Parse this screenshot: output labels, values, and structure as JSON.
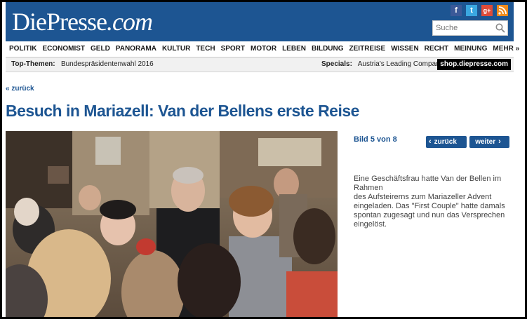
{
  "header": {
    "logo_main": "DiePresse",
    "logo_suffix": ".com",
    "search_placeholder": "Suche",
    "social": [
      {
        "icon": "facebook-icon",
        "glyph": "f",
        "color": "#3b5998"
      },
      {
        "icon": "twitter-icon",
        "glyph": "t",
        "color": "#3aa7e0"
      },
      {
        "icon": "google-plus-icon",
        "glyph": "g+",
        "color": "#dd4b39"
      },
      {
        "icon": "rss-icon",
        "glyph": ")",
        "color": "#f08a1c"
      }
    ]
  },
  "nav": {
    "items": [
      "POLITIK",
      "ECONOMIST",
      "GELD",
      "PANORAMA",
      "KULTUR",
      "TECH",
      "SPORT",
      "MOTOR",
      "LEBEN",
      "BILDUNG",
      "ZEITREISE",
      "WISSEN",
      "RECHT",
      "MEINUNG",
      "MEHR »"
    ]
  },
  "topbar": {
    "topics_label": "Top-Themen:",
    "topics_value": "Bundespräsidentenwahl 2016",
    "specials_label": "Specials:",
    "specials_value": "Austria's Leading Companies",
    "shop": "shop.diepresse.com"
  },
  "article": {
    "back_link": "« zurück",
    "title": "Besuch in Mariazell: Van der Bellens erste Reise",
    "gallery": {
      "counter": "Bild 5 von 8",
      "prev_label": "zurück",
      "next_label": "weiter"
    },
    "caption_lines": [
      "Eine Geschäftsfrau hatte Van der Bellen im",
      "Rahmen",
      "des Aufsteirerns zum Mariazeller Advent",
      "eingeladen. Das \"First Couple\" hatte damals",
      "spontan zugesagt und nun das Versprechen",
      "eingelöst."
    ]
  },
  "colors": {
    "brand_blue": "#1d5592",
    "nav_text": "#1a1a1a",
    "shop_bg": "#000000"
  }
}
